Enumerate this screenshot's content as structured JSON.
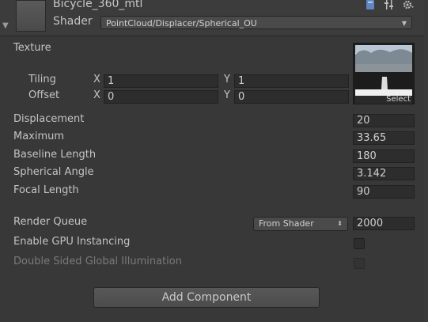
{
  "material": {
    "name": "Bicycle_360_mtl",
    "shader_label": "Shader",
    "shader_value": "PointCloud/Displacer/Spherical_OU"
  },
  "header_icons": [
    "book-icon",
    "settings-sliders-icon",
    "gear-icon"
  ],
  "texture": {
    "label": "Texture",
    "select_label": "Select",
    "tiling_label": "Tiling",
    "offset_label": "Offset",
    "tiling_x_label": "X",
    "tiling_x": "1",
    "tiling_y_label": "Y",
    "tiling_y": "1",
    "offset_x_label": "X",
    "offset_x": "0",
    "offset_y_label": "Y",
    "offset_y": "0"
  },
  "properties": [
    {
      "label": "Displacement",
      "value": "20"
    },
    {
      "label": "Maximum",
      "value": "33.65"
    },
    {
      "label": "Baseline Length",
      "value": "180"
    },
    {
      "label": "Spherical Angle",
      "value": "3.142"
    },
    {
      "label": "Focal Length",
      "value": "90"
    }
  ],
  "render_queue": {
    "label": "Render Queue",
    "dropdown": "From Shader",
    "value": "2000"
  },
  "gpu_instancing": {
    "label": "Enable GPU Instancing",
    "checked": false
  },
  "double_sided_gi": {
    "label": "Double Sided Global Illumination",
    "checked": false,
    "disabled": true
  },
  "add_component_label": "Add Component"
}
